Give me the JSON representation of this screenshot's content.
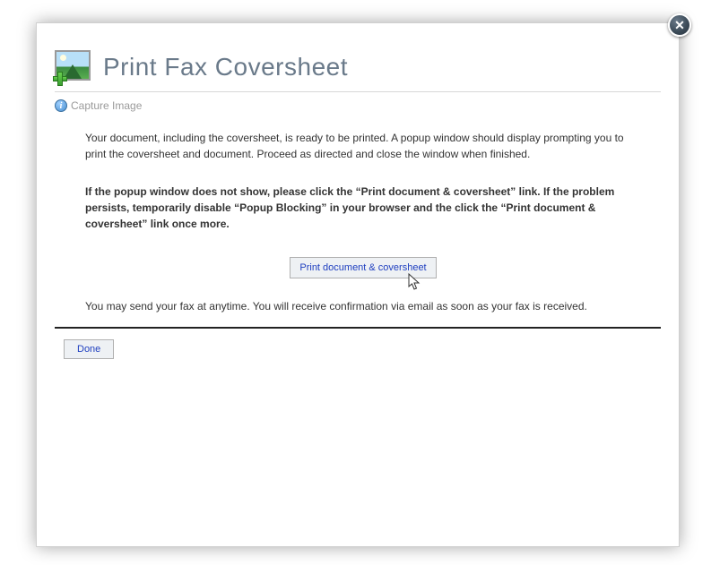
{
  "title": "Print Fax Coversheet",
  "subheader": "Capture Image",
  "para1": "Your document, including the coversheet, is ready to be printed. A popup window should display prompting you to print the coversheet and document. Proceed as directed and close the window when finished.",
  "para2": "If the popup window does not show, please click the “Print document & coversheet” link. If the problem persists, temporarily disable “Popup Blocking” in your browser and the click the “Print document & coversheet” link once more.",
  "printButton": "Print document & coversheet",
  "para3": "You may send your fax at anytime. You will receive confirmation via email as soon as your fax is received.",
  "doneButton": "Done"
}
